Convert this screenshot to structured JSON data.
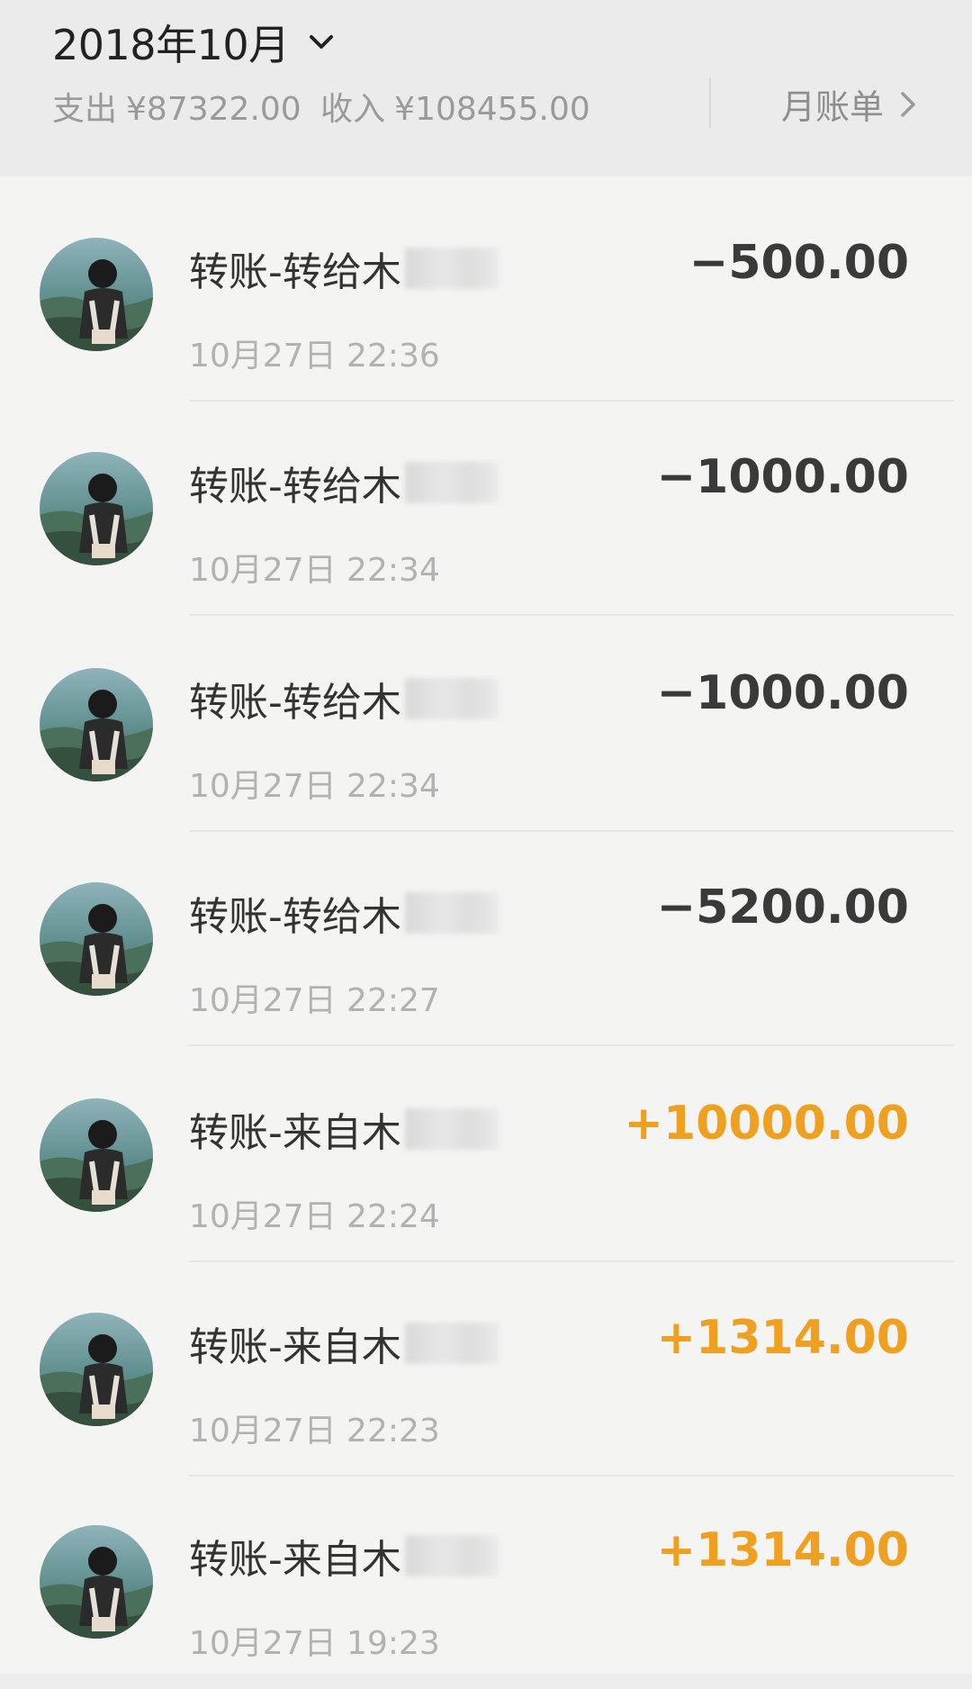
{
  "header": {
    "month_label": "2018年10月",
    "expense_label": "支出",
    "expense_value": "¥87322.00",
    "income_label": "收入",
    "income_value": "¥108455.00",
    "monthly_bill_label": "月账单"
  },
  "transactions": [
    {
      "title": "转账-转给木",
      "time": "10月27日 22:36",
      "amount": "−500.00",
      "type": "expense"
    },
    {
      "title": "转账-转给木",
      "time": "10月27日 22:34",
      "amount": "−1000.00",
      "type": "expense"
    },
    {
      "title": "转账-转给木",
      "time": "10月27日 22:34",
      "amount": "−1000.00",
      "type": "expense"
    },
    {
      "title": "转账-转给木",
      "time": "10月27日 22:27",
      "amount": "−5200.00",
      "type": "expense"
    },
    {
      "title": "转账-来自木",
      "time": "10月27日 22:24",
      "amount": "+10000.00",
      "type": "income"
    },
    {
      "title": "转账-来自木",
      "time": "10月27日 22:23",
      "amount": "+1314.00",
      "type": "income"
    },
    {
      "title": "转账-来自木",
      "time": "10月27日 19:23",
      "amount": "+1314.00",
      "type": "income"
    }
  ],
  "colors": {
    "income": "#f0a020",
    "expense": "#3a3a3a",
    "secondary_text": "#9a9a9a"
  },
  "icons": {
    "month_dropdown": "chevron-down-icon",
    "monthly_bill": "chevron-right-icon",
    "avatar": "user-avatar"
  }
}
